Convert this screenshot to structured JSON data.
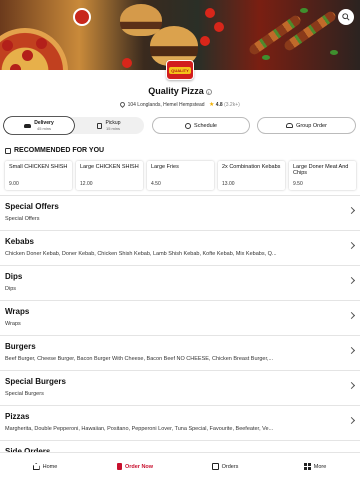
{
  "restaurant": {
    "name": "Quality Pizza",
    "logo_text": "QUALITY",
    "address": "104 Longlands, Hemel Hempstead",
    "rating": "4.8",
    "rating_count": "(3.2k+)"
  },
  "mode": {
    "delivery_label": "Delivery",
    "delivery_time": "45 mins",
    "pickup_label": "Pickup",
    "pickup_time": "15 mins",
    "selected": "delivery"
  },
  "actions": {
    "schedule_label": "Schedule",
    "group_order_label": "Group Order"
  },
  "recommended": {
    "header": "RECOMMENDED FOR YOU",
    "items": [
      {
        "name": "Small CHICKEN SHISH",
        "price": "9.00"
      },
      {
        "name": "Large CHICKEN SHISH",
        "price": "12.00"
      },
      {
        "name": "Large Fries",
        "price": "4.50"
      },
      {
        "name": "2x Combination Kebabs",
        "price": "13.00"
      },
      {
        "name": "Large Doner Meat And Chips",
        "price": "9.50"
      }
    ]
  },
  "categories": [
    {
      "name": "Special Offers",
      "desc": "Special Offers"
    },
    {
      "name": "Kebabs",
      "desc": "Chicken Doner Kebab, Doner Kebab, Chicken Shish Kebab, Lamb Shish Kebab, Kofte Kebab, Mix Kebabs, Q..."
    },
    {
      "name": "Dips",
      "desc": "Dips"
    },
    {
      "name": "Wraps",
      "desc": "Wraps"
    },
    {
      "name": "Burgers",
      "desc": "Beef Burger, Cheese Burger, Bacon Burger With Cheese, Bacon Beef NO CHEESE, Chicken Breast Burger,..."
    },
    {
      "name": "Special Burgers",
      "desc": "Special Burgers"
    },
    {
      "name": "Pizzas",
      "desc": "Margherita, Double Pepperoni, Hawaiian, Positano, Pepperoni Lover, Tuna Special, Favourite, Beefeater, Ve..."
    },
    {
      "name": "Side Orders",
      "desc": ""
    }
  ],
  "nav": {
    "home": "Home",
    "order_now": "Order Now",
    "orders": "Orders",
    "more": "More"
  },
  "colors": {
    "accent": "#c8102e",
    "brand_logo": "#d21d1d",
    "star": "#f2b100"
  },
  "icons": [
    "search-icon",
    "info-icon",
    "location-pin-icon",
    "star-icon",
    "car-icon",
    "bag-icon",
    "clock-icon",
    "people-icon",
    "thumbs-up-icon",
    "chevron-right-icon",
    "home-icon",
    "order-icon",
    "orders-list-icon",
    "more-grid-icon"
  ]
}
